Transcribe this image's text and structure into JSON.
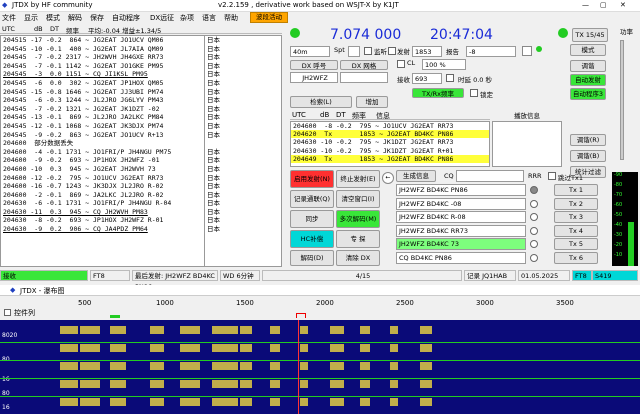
{
  "title_left": "JTDX by HF community",
  "title_center": "v2.2.159 , derivative work based on WSJT-X by K1JT",
  "menu": [
    "文件",
    "显示",
    "模式",
    "解码",
    "保存",
    "自动程序",
    "DX远征",
    "杂项",
    "语言",
    "帮助"
  ],
  "list_header": [
    "UTC",
    "dB",
    "DT",
    "频率",
    "平均:-0.04 增益±1.34/5"
  ],
  "rx_header": "波段活动",
  "decodes": [
    {
      "text": "204515 -17 -0.2  864 ~ JG2EAT JO1UCV QM06",
      "country": "日本"
    },
    {
      "text": "204545 -10 -0.1  400 ~ JG2EAT JL7AIA QM09",
      "country": "日本"
    },
    {
      "text": "204545  -7 -0.2 2317 ~ JH2WVH JH4GXE RR73",
      "country": "日本"
    },
    {
      "text": "204545  -7 -0.1 1142 ~ JG2EAT JO1GKE PM95",
      "country": "日本"
    },
    {
      "text": "204545  -3  0.0 1151 ~ CQ JI1KSL PM95",
      "country": "日本"
    },
    {
      "text": "204545  -6  0.0  302 ~ JG2EAT JP1HOX QM05",
      "country": "日本"
    },
    {
      "text": "204545 -15 -0.8 1646 ~ JG2EAT JJ3UBI PM74",
      "country": "日本"
    },
    {
      "text": "204545  -6 -0.3 1244 ~ JL2JRO JG6LYV PM43",
      "country": "日本"
    },
    {
      "text": "204545  -7 -0.2 1321 ~ JG2EAT JK1DZT -02",
      "country": "日本"
    },
    {
      "text": "204545 -13 -0.1  869 ~ JL2JRO JA2LKC PM84",
      "country": "日本"
    },
    {
      "text": "204545 -12 -0.1 1068 ~ JG2EAT JK3DJX PM74",
      "country": "日本"
    },
    {
      "text": "204545  -9 -0.2  863 ~ JG2EAT JO1UCV R+13",
      "country": "日本"
    },
    {
      "text": "204600  部分数据丢失",
      "country": ""
    },
    {
      "text": "204600  -4 -0.1 1731 ~ JO1FRI/P JH4NGU PM75",
      "country": "日本"
    },
    {
      "text": "204600  -9 -0.2  693 ~ JP1HOX JH2WFZ -01",
      "country": "日本"
    },
    {
      "text": "204600 -10  0.3  945 ~ JG2EAT JH2WVH 73",
      "country": "日本"
    },
    {
      "text": "204600 -12 -0.2  795 ~ JO1UCV JG2EAT RR73",
      "country": "日本"
    },
    {
      "text": "204600 -16 -0.7 1243 ~ JK3DJX JL2JRO R-02",
      "country": "日本"
    },
    {
      "text": "204600  -2 -0.1  869 ~ JA2LKC JL2JRO R-02",
      "country": "日本"
    },
    {
      "text": "204630  -6 -0.1 1731 ~ JO1FRI/P JH4NGU R-04",
      "country": "日本"
    },
    {
      "text": "204630 -11  0.3  945 ~ CQ JH2WVH PM83",
      "country": "日本"
    },
    {
      "text": "204630  -8 -0.2  693 ~ JP1HOX JH2WFZ R-01",
      "country": "日本"
    },
    {
      "text": "204630  -9  0.2  906 ~ CQ JA4PDZ PM64",
      "country": "日本"
    }
  ],
  "band": "40m",
  "frequency": "7.074 000",
  "clock": "20:47:04",
  "spt_label": "Spt",
  "spt_value": "",
  "monitor_label": "监听",
  "tx_label": "TX 15/45",
  "dx_call_label": "DX 呼号",
  "dx_grid_label": "DX 网格",
  "dx_call": "JH2WFZ",
  "dx_grid": "",
  "lookup_btn": "检索(L)",
  "add_btn": "增加",
  "tx_freq_label": "发射",
  "tx_freq": "1853",
  "auto_rx_label": "接收",
  "rx_freq": "693",
  "report_label": "报告",
  "report_value": "-8",
  "cl_label": "CL",
  "cl_value": "100 %",
  "tx_rx_same": "TX/Rx频率",
  "tune_label": "调谐",
  "hold_label": "锁定",
  "delay_label": "时延 0.0 秒",
  "auto_tx_btn": "自动发射",
  "auto_seq_btn": "自动程序3",
  "ab_btn": "模式",
  "mid_header": [
    "UTC",
    "dB",
    "DT",
    "频率",
    "信息"
  ],
  "mid_rows": [
    {
      "text": "204600  -8 -0.2  795 ~ JO1UCV JG2EAT RR73",
      "c": "日本",
      "hl": ""
    },
    {
      "text": "204620  Tx       1853 ~ JG2EAT BD4KC PN86",
      "c": "",
      "hl": "yellow"
    },
    {
      "text": "204630 -10 -0.2  795 ~ JK1DZT JG2EAT RR73",
      "c": "日本",
      "hl": ""
    },
    {
      "text": "204630 -10 -0.2  795 ~ JK1DZT JG2EAT R+01",
      "c": "日本",
      "hl": ""
    },
    {
      "text": "204649  Tx       1853 ~ JG2EAT BD4KC PN86",
      "c": "",
      "hl": "yellow"
    }
  ],
  "mid_extra_header": "播放信息",
  "buttons": {
    "enable_tx": "启用发射(N)",
    "stop_tx": "终止发射(E)",
    "log_qso": "记录通联(Q)",
    "clear_win": "清空窗口(I)",
    "sync": "同步",
    "multi_decode": "多次解码(M)",
    "hc": "HC补偿",
    "cq": "专 探",
    "decode": "解码(D)",
    "erase": "清除 DX",
    "generate": "生成信息",
    "skip_tx1": "跳过Tx1",
    "call": "调谐(R)",
    "tx_first": "调谐(R)",
    "right_stop": "调谐(R)",
    "right_b1": "调谐(R)",
    "right_b2": "调谐(B)",
    "right_b3": "统计过滤"
  },
  "cq_label": "CQ",
  "rrr_label": "RRR",
  "tx_messages": [
    {
      "text": "JH2WFZ BD4KC PN86",
      "btn": "Tx 1"
    },
    {
      "text": "JH2WFZ BD4KC -08",
      "btn": "Tx 2"
    },
    {
      "text": "JH2WFZ BD4KC R-08",
      "btn": "Tx 3"
    },
    {
      "text": "JH2WFZ BD4KC RR73",
      "btn": "Tx 4"
    },
    {
      "text": "JH2WFZ BD4KC 73",
      "btn": "Tx 5"
    },
    {
      "text": "CQ BD4KC PN86",
      "btn": "Tx 6"
    }
  ],
  "power_label": "功率",
  "meter_label": "dB",
  "meter_ticks": [
    "-90",
    "-80",
    "-70",
    "-60",
    "-50",
    "-40",
    "-30",
    "-20",
    "-10"
  ],
  "status": {
    "rx": "接收",
    "mode": "FT8",
    "last_tx": "最后发射: JH2WFZ BD4KC PN86",
    "wd": "WD 6分钟",
    "count": "4/15",
    "logged": "记录 JQ1HAB",
    "date": "01.05.2025",
    "mode2": "FT8",
    "rate": "S419"
  },
  "waterfall_title": "JTDX - 瀑布图",
  "wf_control_label": "控件列",
  "wf_ticks": [
    "500",
    "1000",
    "1500",
    "2000",
    "2500",
    "3000",
    "3500"
  ],
  "wf_labels": [
    "8020",
    "80",
    "16",
    "80",
    "16"
  ]
}
